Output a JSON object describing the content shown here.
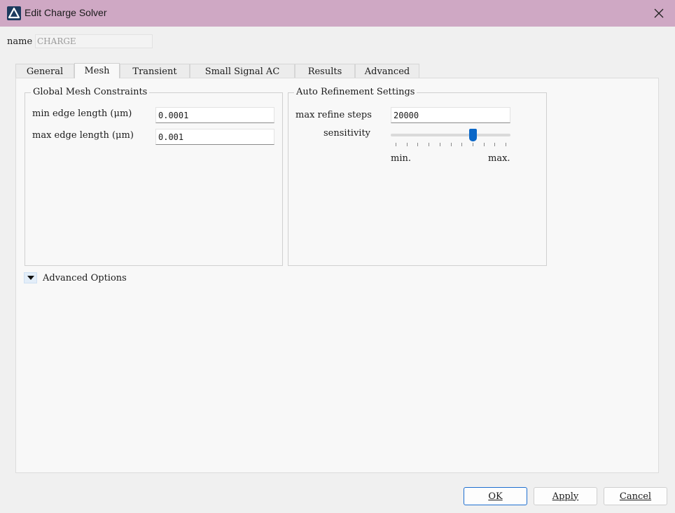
{
  "window": {
    "title": "Edit Charge Solver",
    "icon": "app-logo-icon",
    "close_icon": "close-icon"
  },
  "name_field": {
    "label": "name",
    "value": "CHARGE"
  },
  "tabs": [
    {
      "label": "General"
    },
    {
      "label": "Mesh",
      "active": true
    },
    {
      "label": "Transient"
    },
    {
      "label": "Small Signal AC"
    },
    {
      "label": "Results"
    },
    {
      "label": "Advanced"
    }
  ],
  "mesh": {
    "global_constraints": {
      "title": "Global Mesh Constraints",
      "min_edge_label": "min edge length (μm)",
      "min_edge_value": "0.0001",
      "max_edge_label": "max edge length (μm)",
      "max_edge_value": "0.001"
    },
    "auto_refinement": {
      "title": "Auto Refinement Settings",
      "max_refine_label": "max refine steps",
      "max_refine_value": "20000",
      "sensitivity_label": "sensitivity",
      "sensitivity_value": 0.7,
      "min_label": "min.",
      "max_label": "max."
    },
    "advanced_options_label": "Advanced Options"
  },
  "buttons": {
    "ok": "OK",
    "apply": "Apply",
    "cancel": "Cancel"
  },
  "colors": {
    "titlebar": "#cfa8c4",
    "accent": "#0a67c8"
  }
}
